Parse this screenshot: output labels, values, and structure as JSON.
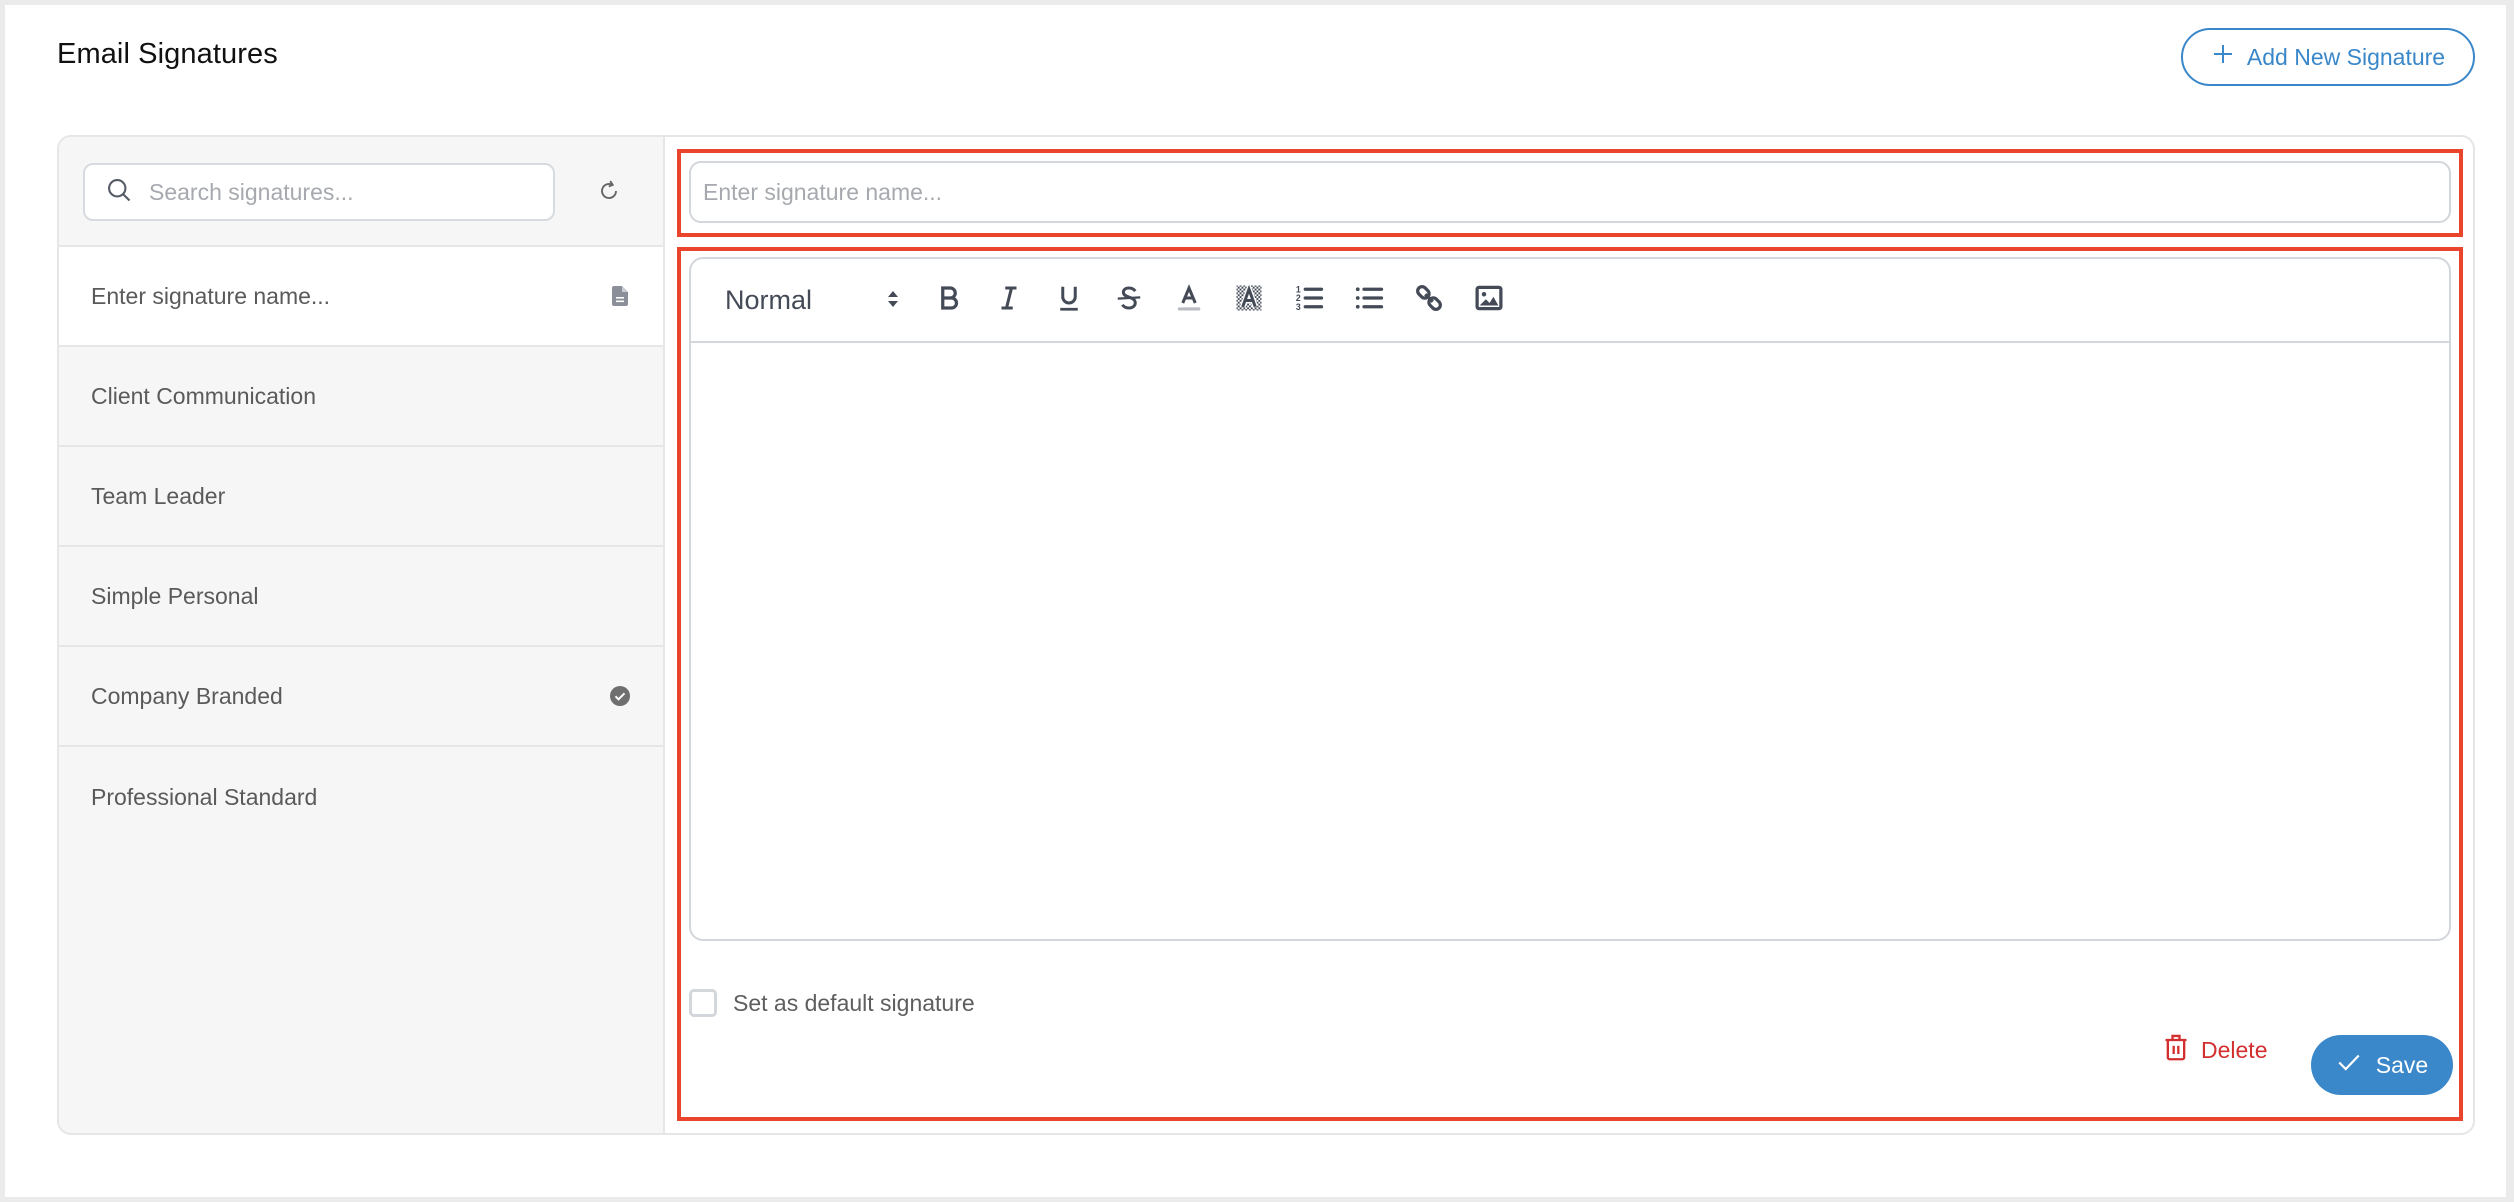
{
  "header": {
    "title": "Email Signatures",
    "add_button_label": "Add New Signature",
    "add_icon": "plus-icon"
  },
  "sidebar": {
    "search": {
      "placeholder": "Search signatures...",
      "value": "",
      "icon": "search-icon"
    },
    "refresh_icon": "refresh-icon",
    "items": [
      {
        "label": "Enter signature name...",
        "icon": "document-icon",
        "active": true
      },
      {
        "label": "Client Communication",
        "icon": "",
        "active": false
      },
      {
        "label": "Team Leader",
        "icon": "",
        "active": false
      },
      {
        "label": "Simple Personal",
        "icon": "",
        "active": false
      },
      {
        "label": "Company Branded",
        "icon": "check-circle-icon",
        "active": false,
        "is_default": true
      },
      {
        "label": "Professional Standard",
        "icon": "",
        "active": false
      }
    ]
  },
  "editor": {
    "name_input": {
      "placeholder": "Enter signature name...",
      "value": ""
    },
    "toolbar": {
      "format_select": "Normal",
      "buttons": [
        {
          "name": "bold",
          "icon": "bold-icon"
        },
        {
          "name": "italic",
          "icon": "italic-icon"
        },
        {
          "name": "underline",
          "icon": "underline-icon"
        },
        {
          "name": "strikethrough",
          "icon": "strikethrough-icon"
        },
        {
          "name": "text-color",
          "icon": "text-color-icon"
        },
        {
          "name": "background-color",
          "icon": "highlight-icon"
        },
        {
          "name": "ordered-list",
          "icon": "ordered-list-icon"
        },
        {
          "name": "bullet-list",
          "icon": "bullet-list-icon"
        },
        {
          "name": "link",
          "icon": "link-icon"
        },
        {
          "name": "image",
          "icon": "image-icon"
        }
      ]
    },
    "content": "",
    "default_checkbox": {
      "label": "Set as default signature",
      "checked": false
    },
    "delete_label": "Delete",
    "save_label": "Save"
  },
  "colors": {
    "accent": "#3a87c9",
    "danger": "#d32f2f",
    "highlight_outline": "#e8452c",
    "icon": "#444b57"
  }
}
